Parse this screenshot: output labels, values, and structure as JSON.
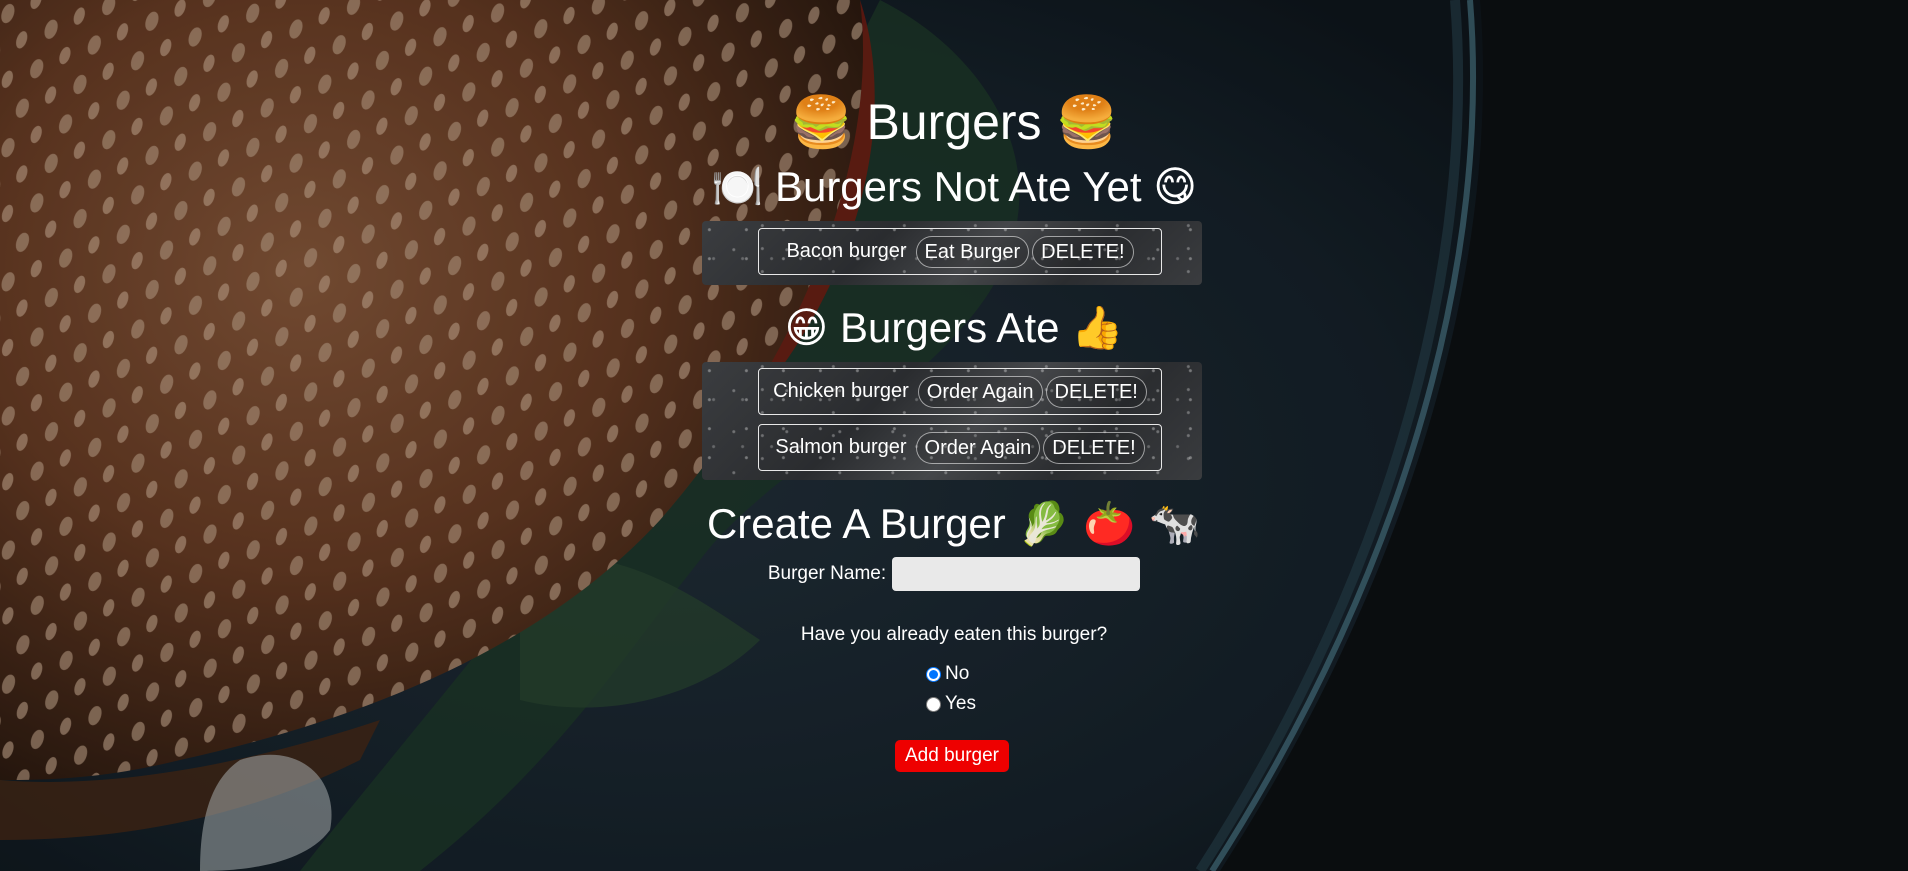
{
  "header": {
    "title": "Burgers",
    "title_emoji": "🍔"
  },
  "not_ate": {
    "heading": "Burgers Not Ate Yet",
    "emoji_left": "🍽️",
    "emoji_right": "😋",
    "items": [
      {
        "name": "Bacon burger",
        "action_label": "Eat Burger",
        "delete_label": "DELETE!"
      }
    ]
  },
  "ate": {
    "heading": "Burgers Ate",
    "emoji_left": "😁",
    "emoji_right": "👍",
    "items": [
      {
        "name": "Chicken burger",
        "action_label": "Order Again",
        "delete_label": "DELETE!"
      },
      {
        "name": "Salmon burger",
        "action_label": "Order Again",
        "delete_label": "DELETE!"
      }
    ]
  },
  "create": {
    "heading": "Create A Burger",
    "emojis": "🥬 🍅 🐄",
    "name_label": "Burger Name:",
    "name_value": "",
    "question": "Have you already eaten this burger?",
    "options": [
      {
        "label": "No",
        "checked": true
      },
      {
        "label": "Yes",
        "checked": false
      }
    ],
    "submit_label": "Add burger"
  },
  "colors": {
    "submit_button": "#ee0000",
    "text": "#ffffff",
    "background": "#0d1013"
  }
}
